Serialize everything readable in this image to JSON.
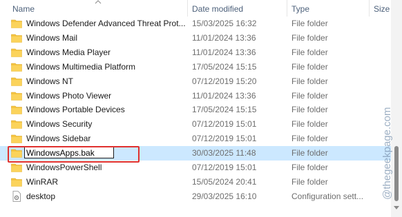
{
  "header": {
    "name": "Name",
    "date_modified": "Date modified",
    "type": "Type",
    "size": "Size"
  },
  "rows": [
    {
      "name": "Windows Defender Advanced Threat Prot...",
      "date": "15/03/2025 16:32",
      "type": "File folder",
      "icon": "folder-icon"
    },
    {
      "name": "Windows Mail",
      "date": "11/01/2024 13:36",
      "type": "File folder",
      "icon": "folder-icon"
    },
    {
      "name": "Windows Media Player",
      "date": "11/01/2024 13:36",
      "type": "File folder",
      "icon": "folder-icon"
    },
    {
      "name": "Windows Multimedia Platform",
      "date": "17/05/2024 15:15",
      "type": "File folder",
      "icon": "folder-icon"
    },
    {
      "name": "Windows NT",
      "date": "07/12/2019 15:20",
      "type": "File folder",
      "icon": "folder-icon"
    },
    {
      "name": "Windows Photo Viewer",
      "date": "11/01/2024 13:36",
      "type": "File folder",
      "icon": "folder-icon"
    },
    {
      "name": "Windows Portable Devices",
      "date": "17/05/2024 15:15",
      "type": "File folder",
      "icon": "folder-icon"
    },
    {
      "name": "Windows Security",
      "date": "07/12/2019 15:01",
      "type": "File folder",
      "icon": "folder-icon"
    },
    {
      "name": "Windows Sidebar",
      "date": "07/12/2019 15:01",
      "type": "File folder",
      "icon": "folder-icon"
    },
    {
      "name": "WindowsApps.bak",
      "date": "30/03/2025 11:48",
      "type": "File folder",
      "icon": "folder-icon"
    },
    {
      "name": "WindowsPowerShell",
      "date": "07/12/2019 15:01",
      "type": "File folder",
      "icon": "folder-icon"
    },
    {
      "name": "WinRAR",
      "date": "15/05/2024 20:41",
      "type": "File folder",
      "icon": "folder-icon"
    },
    {
      "name": "desktop",
      "date": "29/03/2025 16:10",
      "type": "Configuration sett...",
      "icon": "settings-file-icon"
    }
  ],
  "rename": {
    "value": "WindowsApps.bak"
  },
  "watermark": "@thegeekpage.com",
  "colors": {
    "folder": "#f5c542",
    "selection": "#cce8ff",
    "highlight": "#e0302e",
    "header_text": "#4c607a"
  }
}
